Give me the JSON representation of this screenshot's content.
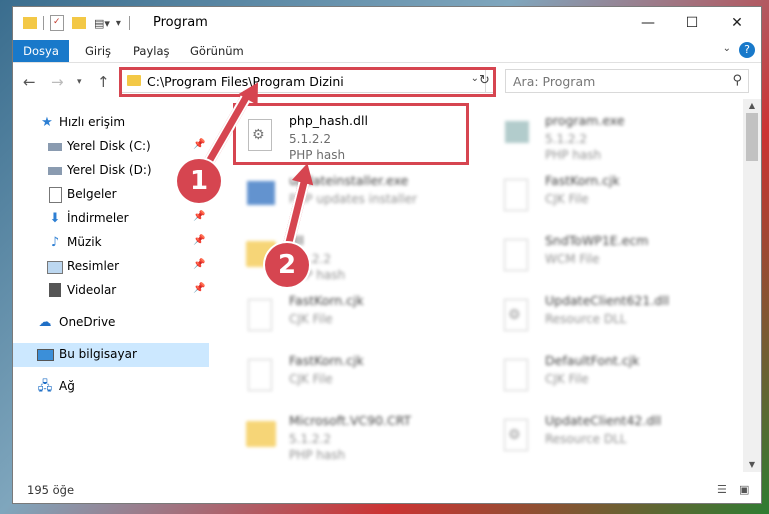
{
  "window": {
    "title": "Program",
    "minimize": "—",
    "maximize": "☐",
    "close": "✕"
  },
  "ribbon": {
    "tabs": [
      "Dosya",
      "Giriş",
      "Paylaş",
      "Görünüm"
    ],
    "help": "?"
  },
  "address": {
    "path": "C:\\Program Files\\Program Dizini",
    "search_placeholder": "Ara: Program"
  },
  "sidebar": {
    "items": [
      {
        "label": "Hızlı erişim",
        "icon": "star-icon",
        "pinned": false
      },
      {
        "label": "Yerel Disk (C:)",
        "icon": "drive-icon",
        "pinned": true
      },
      {
        "label": "Yerel Disk (D:)",
        "icon": "drive-icon",
        "pinned": false
      },
      {
        "label": "Belgeler",
        "icon": "documents-icon",
        "pinned": true
      },
      {
        "label": "İndirmeler",
        "icon": "download-icon",
        "pinned": true
      },
      {
        "label": "Müzik",
        "icon": "music-icon",
        "pinned": true
      },
      {
        "label": "Resimler",
        "icon": "pictures-icon",
        "pinned": true
      },
      {
        "label": "Videolar",
        "icon": "video-icon",
        "pinned": true
      },
      {
        "label": "OneDrive",
        "icon": "cloud-icon",
        "pinned": false
      },
      {
        "label": "Bu bilgisayar",
        "icon": "computer-icon",
        "pinned": false
      },
      {
        "label": "Ağ",
        "icon": "network-icon",
        "pinned": false
      }
    ]
  },
  "files": [
    {
      "name": "php_hash.dll",
      "line2": "5.1.2.2",
      "line3": "PHP hash",
      "icon": "dll-gear-icon",
      "blurred": false
    },
    {
      "name": "program.exe",
      "line2": "5.1.2.2",
      "line3": "PHP hash",
      "icon": "exe-icon",
      "blurred": true
    },
    {
      "name": "updateinstaller.exe",
      "line2": "PHP updates installer",
      "line3": "",
      "icon": "installer-icon",
      "blurred": true
    },
    {
      "name": "FastKorn.cjk",
      "line2": "CJK File",
      "line3": "",
      "icon": "file-icon",
      "blurred": true
    },
    {
      "name": "dll",
      "line2": "5.1.2.2",
      "line3": "PHP hash",
      "icon": "folder-icon",
      "blurred": true
    },
    {
      "name": "SndToWP1E.ecm",
      "line2": "WCM File",
      "line3": "",
      "icon": "file-icon",
      "blurred": true
    },
    {
      "name": "FastKorn.cjk",
      "line2": "CJK File",
      "line3": "",
      "icon": "file-icon",
      "blurred": true
    },
    {
      "name": "UpdateClient621.dll",
      "line2": "Resource DLL",
      "line3": "",
      "icon": "dll-gear-icon",
      "blurred": true
    },
    {
      "name": "FastKorn.cjk",
      "line2": "CJK File",
      "line3": "",
      "icon": "file-icon",
      "blurred": true
    },
    {
      "name": "DefaultFont.cjk",
      "line2": "CJK File",
      "line3": "",
      "icon": "file-icon",
      "blurred": true
    },
    {
      "name": "Microsoft.VC90.CRT",
      "line2": "5.1.2.2",
      "line3": "PHP hash",
      "icon": "folder-icon",
      "blurred": true
    },
    {
      "name": "UpdateClient42.dll",
      "line2": "Resource DLL",
      "line3": "",
      "icon": "dll-gear-icon",
      "blurred": true
    }
  ],
  "status": {
    "count": "195 öğe"
  },
  "annotations": {
    "step1": "1",
    "step2": "2",
    "color": "#d64550"
  }
}
